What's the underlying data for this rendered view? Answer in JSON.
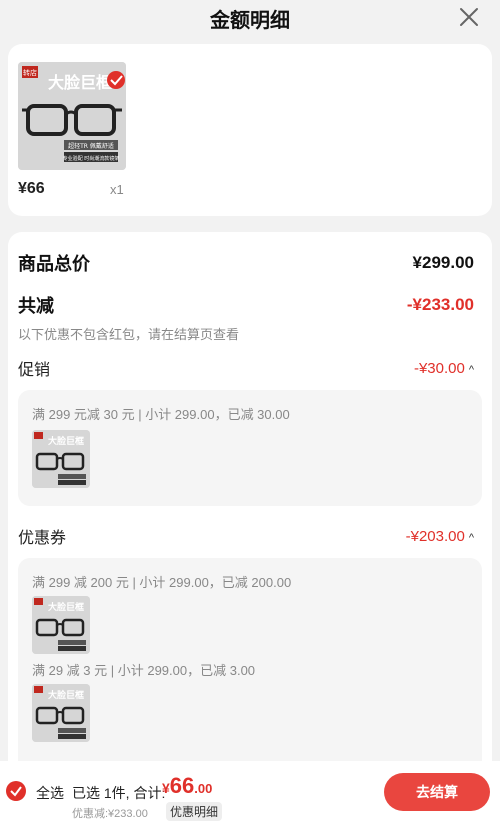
{
  "header": {
    "title": "金额明细"
  },
  "product": {
    "badge": "转店",
    "banner": "大脸巨框",
    "tag1": "超轻TR 佩戴舒适",
    "tag2": "专业验配 时尚潮流款镜架",
    "price": "¥66",
    "qty": "x1"
  },
  "summary": {
    "total_label": "商品总价",
    "total_value": "¥299.00",
    "discount_label": "共减",
    "discount_value": "-¥233.00",
    "note": "以下优惠不包含红包，请在结算页查看"
  },
  "promotion": {
    "label": "促销",
    "value": "-¥30.00",
    "rule": "满 299 元减 30 元 | 小计 299.00，已减 30.00"
  },
  "coupon": {
    "label": "优惠券",
    "value": "-¥203.00",
    "rule1": "满 299 减 200 元 | 小计 299.00，已减 200.00",
    "rule2": "满 29 减 3 元 | 小计 299.00，已减 3.00"
  },
  "bottom": {
    "select_all": "全选",
    "selected": "已选 1件, 合计:",
    "yen": "¥",
    "total_int": "66",
    "total_dec": ".00",
    "saved": "优惠减:¥233.00",
    "detail": "优惠明细",
    "checkout": "去结算"
  },
  "colors": {
    "accent": "#e0302a",
    "background": "#f2f2f2"
  }
}
